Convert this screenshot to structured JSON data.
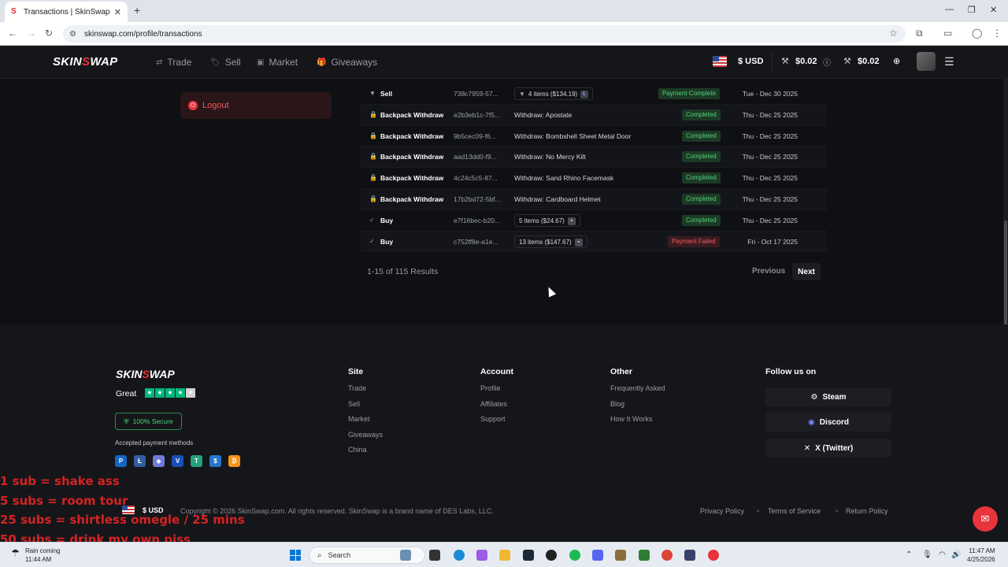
{
  "browser": {
    "tab_title": "Transactions | SkinSwap",
    "url": "skinswap.com/profile/transactions"
  },
  "header": {
    "logo_left": "SKIN",
    "logo_s": "S",
    "logo_right": "WAP",
    "nav": [
      {
        "label": "Trade",
        "icon": "trade-icon"
      },
      {
        "label": "Sell",
        "icon": "sell-icon"
      },
      {
        "label": "Market",
        "icon": "market-icon"
      },
      {
        "label": "Giveaways",
        "icon": "giveaways-icon"
      }
    ],
    "currency": "$ USD",
    "balance_1": "$0.02",
    "balance_2": "$0.02"
  },
  "sidebar": {
    "logout_label": "Logout"
  },
  "transactions": [
    {
      "type": "Sell",
      "id": "738c7959-57...",
      "items": "4 items ($134.19)",
      "status": "Payment Complete",
      "status_kind": "ok",
      "date": "Tue - Dec 30 2025",
      "icon": "chevron-down-icon"
    },
    {
      "type": "Backpack Withdraw",
      "id": "e2b3eb1c-7f5...",
      "desc": "Withdraw: Apostate",
      "status": "Completed",
      "status_kind": "ok",
      "date": "Thu - Dec 25 2025",
      "icon": "lock-icon"
    },
    {
      "type": "Backpack Withdraw",
      "id": "9b5cec09-f6...",
      "desc": "Withdraw: Bombshell Sheet Metal Door",
      "status": "Completed",
      "status_kind": "ok",
      "date": "Thu - Dec 25 2025",
      "icon": "lock-icon"
    },
    {
      "type": "Backpack Withdraw",
      "id": "aad13dd0-f9...",
      "desc": "Withdraw: No Mercy Kilt",
      "status": "Completed",
      "status_kind": "ok",
      "date": "Thu - Dec 25 2025",
      "icon": "lock-icon"
    },
    {
      "type": "Backpack Withdraw",
      "id": "4c24c5c5-87...",
      "desc": "Withdraw: Sand Rhino Facemask",
      "status": "Completed",
      "status_kind": "ok",
      "date": "Thu - Dec 25 2025",
      "icon": "lock-icon"
    },
    {
      "type": "Backpack Withdraw",
      "id": "17b2bd72-5bf...",
      "desc": "Withdraw: Cardboard Helmet",
      "status": "Completed",
      "status_kind": "ok",
      "date": "Thu - Dec 25 2025",
      "icon": "lock-icon"
    },
    {
      "type": "Buy",
      "id": "e7f16bec-b20...",
      "items": "5 items ($24.67)",
      "status": "Completed",
      "status_kind": "ok",
      "date": "Thu - Dec 25 2025",
      "icon": "check-icon"
    },
    {
      "type": "Buy",
      "id": "c752ff8e-a1e...",
      "items": "13 items ($147.67)",
      "status": "Payment Failed",
      "status_kind": "fail",
      "date": "Fri - Oct 17 2025",
      "icon": "check-icon"
    }
  ],
  "pagination": {
    "results": "1-15 of 115 Results",
    "previous": "Previous",
    "next": "Next"
  },
  "footer": {
    "rating_word": "Great",
    "secure_label": "100% Secure",
    "payment_title": "Accepted payment methods",
    "site": {
      "title": "Site",
      "links": [
        "Trade",
        "Sell",
        "Market",
        "Giveaways",
        "China"
      ]
    },
    "account": {
      "title": "Account",
      "links": [
        "Profile",
        "Affiliates",
        "Support"
      ]
    },
    "other": {
      "title": "Other",
      "links": [
        "Frequently Asked",
        "Blog",
        "How It Works"
      ]
    },
    "follow": {
      "title": "Follow us on",
      "steam": "Steam",
      "discord": "Discord",
      "x": "X (Twitter)"
    },
    "currency": "$ USD",
    "copyright": "Copyright © 2026 SkinSwap.com. All rights reserved. SkinSwap is a brand name of DES Labs, LLC.",
    "privacy": "Privacy Policy",
    "terms": "Terms of Service",
    "return": "Return Policy"
  },
  "overlay_lines": [
    "1 sub = shake ass",
    "5 subs = room tour",
    "25 subs = shirtless omegle / 25 mins",
    "50 subs = drink my own piss"
  ],
  "taskbar": {
    "weather_line1": "Rain coming",
    "weather_line2": "11:44 AM",
    "search": "Search",
    "time": "11:47 AM",
    "date": "4/25/2026"
  }
}
